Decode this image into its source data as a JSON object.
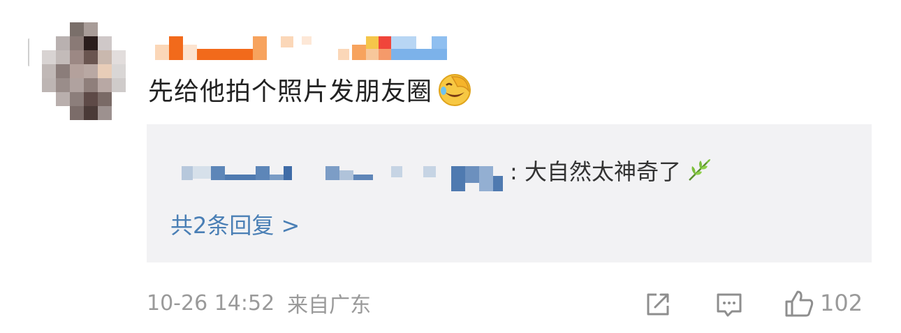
{
  "comment": {
    "text": "先给他拍个照片发朋友圈",
    "emoji": "laughing-crying-emoji"
  },
  "reply": {
    "text": ": 大自然太神奇了",
    "emoji": "leaf-emoji",
    "more_link": "共2条回复 >"
  },
  "footer": {
    "time": "10-26 14:52",
    "location": "来自广东"
  },
  "actions": {
    "share_icon": "share-icon",
    "comment_icon": "comment-icon",
    "like_icon": "thumbs-up-icon",
    "like_count": "102"
  },
  "colors": {
    "link": "#4a7fb5",
    "reply_bg": "#f2f2f4",
    "meta": "#9a9a9a"
  }
}
